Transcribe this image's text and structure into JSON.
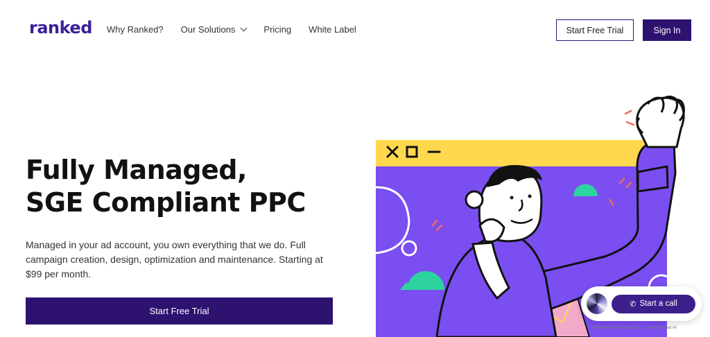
{
  "brand": {
    "logo": "ranked",
    "accent": "#2e1270"
  },
  "nav": {
    "items": [
      {
        "label": "Why Ranked?"
      },
      {
        "label": "Our Solutions",
        "has_dropdown": true
      },
      {
        "label": "Pricing"
      },
      {
        "label": "White Label"
      }
    ]
  },
  "header": {
    "trial_label": "Start Free Trial",
    "signin_label": "Sign In"
  },
  "hero": {
    "title_line1": "Fully Managed,",
    "title_line2": "SGE Compliant PPC",
    "description": "Managed in your ad account, you own everything that we do. Full campaign creation, design, optimization and maintenance. Starting at $99 per month.",
    "cta_label": "Start Free Trial"
  },
  "illustration": {
    "window_controls": [
      "close-icon",
      "square-icon",
      "minimize-icon"
    ],
    "colors": {
      "window_bar": "#ffd84d",
      "panel": "#7a4ef0",
      "accent_green": "#2dd4a0",
      "accent_pink": "#f3a9c9",
      "accent_red": "#f06a5a"
    }
  },
  "chat": {
    "button_label": "Start a call",
    "powered_by": "Powered by ElevenLabs Conversational AI"
  }
}
